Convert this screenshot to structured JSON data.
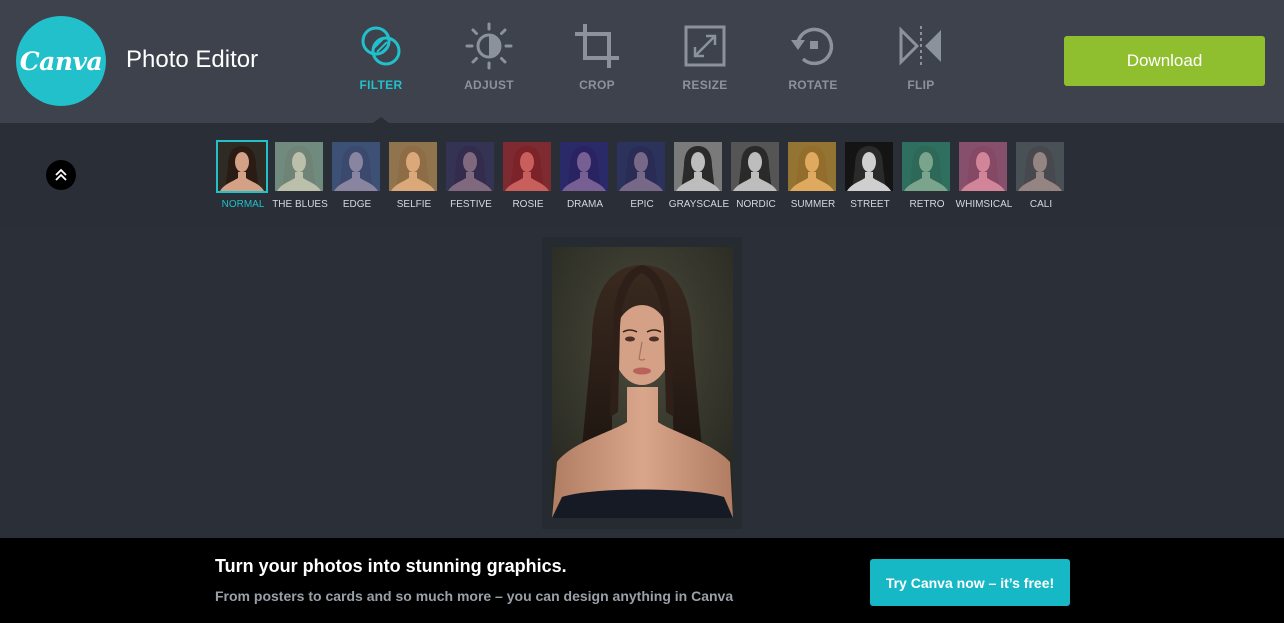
{
  "header": {
    "logo_text": "Canva",
    "title": "Photo Editor",
    "download_label": "Download",
    "accent_color": "#21c0cb",
    "download_color": "#8fbf2e"
  },
  "tools": [
    {
      "label": "FILTER",
      "icon": "filter-icon",
      "active": true
    },
    {
      "label": "ADJUST",
      "icon": "adjust-icon",
      "active": false
    },
    {
      "label": "CROP",
      "icon": "crop-icon",
      "active": false
    },
    {
      "label": "RESIZE",
      "icon": "resize-icon",
      "active": false
    },
    {
      "label": "ROTATE",
      "icon": "rotate-icon",
      "active": false
    },
    {
      "label": "FLIP",
      "icon": "flip-icon",
      "active": false
    }
  ],
  "filters": [
    {
      "label": "NORMAL",
      "active": true,
      "tint": "none"
    },
    {
      "label": "THE BLUES",
      "active": false,
      "tint": "#a8d8c8"
    },
    {
      "label": "EDGE",
      "active": false,
      "tint": "#4a6fb8"
    },
    {
      "label": "SELFIE",
      "active": false,
      "tint": "#e0b070"
    },
    {
      "label": "FESTIVE",
      "active": false,
      "tint": "#3a3a7a"
    },
    {
      "label": "ROSIE",
      "active": false,
      "tint": "#c02a3a"
    },
    {
      "label": "DRAMA",
      "active": false,
      "tint": "#2a2aa0"
    },
    {
      "label": "EPIC",
      "active": false,
      "tint": "#2a3a8a"
    },
    {
      "label": "GRAYSCALE",
      "active": false,
      "tint": "grayscale-light"
    },
    {
      "label": "NORDIC",
      "active": false,
      "tint": "grayscale"
    },
    {
      "label": "SUMMER",
      "active": false,
      "tint": "#e8b040"
    },
    {
      "label": "STREET",
      "active": false,
      "tint": "grayscale-dark"
    },
    {
      "label": "RETRO",
      "active": false,
      "tint": "#30a890"
    },
    {
      "label": "WHIMSICAL",
      "active": false,
      "tint": "#d070a8"
    },
    {
      "label": "CALI",
      "active": false,
      "tint": "#607080"
    }
  ],
  "promo": {
    "headline": "Turn your photos into stunning graphics.",
    "subtext": "From posters to cards and so much more – you can design anything in Canva",
    "cta_label": "Try Canva now – it’s free!"
  }
}
